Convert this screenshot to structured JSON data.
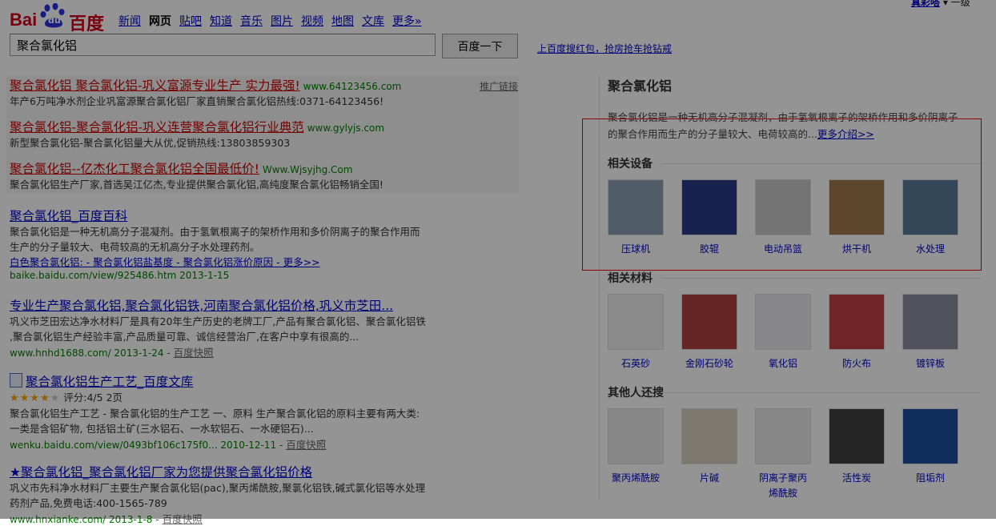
{
  "logo": {
    "text_left": "Bai",
    "text_paw": "du",
    "text_right": "百度"
  },
  "nav": [
    "新闻",
    "网页",
    "贴吧",
    "知道",
    "音乐",
    "图片",
    "视频",
    "地图",
    "文库",
    "更多»"
  ],
  "nav_active": "网页",
  "user": {
    "name": "真彩嗒",
    "setting": "一级"
  },
  "search": {
    "value": "聚合氯化铝",
    "button": "百度一下"
  },
  "promo_link": "上百度搜红包，抢房抢车抢钻戒",
  "ad_label": "推广链接",
  "ads": [
    {
      "title": "聚合氯化铝 聚合氯化铝-巩义富源专业生产 实力最强!",
      "url": "www.64123456.com",
      "desc": "年产6万吨净水剂企业巩富源聚合氯化铝厂家直销聚合氯化铝热线:0371-64123456!"
    },
    {
      "title": "聚合氯化铝-聚合氯化铝-巩义连营聚合氯化铝行业典范",
      "url": "www.gylyjs.com",
      "desc": "新型聚合氯化铝-聚合氯化铝量大从优,促销热线:13803859303"
    },
    {
      "title": "聚合氯化铝--亿杰化工聚合氯化铝全国最低价!",
      "url": "Www.Wjsyjhg.Com",
      "desc": "聚合氯化铝生产厂家,首选吴江亿杰,专业提供聚合氯化铝,高纯度聚合氯化铝畅销全国!"
    }
  ],
  "results": [
    {
      "title": "聚合氯化铝_百度百科",
      "desc1": "聚合氯化铝是一种无机高分子混凝剂。由于氢氧根离子的架桥作用和多价阴离子的聚合作用而",
      "desc2": "生产的分子量较大、电荷较高的无机高分子水处理药剂。",
      "sub": "白色聚合氯化铝: - 聚合氯化铝盐基度 - 聚合氯化铝涨价原因 - 更多>>",
      "url": "baike.baidu.com/view/925486.htm 2013-1-15"
    },
    {
      "title": "专业生产聚合氯化铝,聚合氯化铝铁,河南聚合氯化铝价格,巩义市芝田...",
      "desc1": "巩义市芝田宏达净水材料厂是具有20年生产历史的老牌工厂,产品有聚合氯化铝、聚合氯化铝铁",
      "desc2": ",聚合氯化铝生产经验丰富,产品质量可靠、诚信经营治厂,在客户中享有很高的...",
      "url": "www.hnhd1688.com/ 2013-1-24 -",
      "cache": "百度快照"
    },
    {
      "title": "聚合氯化铝生产工艺_百度文库",
      "rating": "评分:4/5 2页",
      "desc1": "聚合氯化铝生产工艺 - 聚合氯化铝的生产工艺 一、原料 生产聚合氯化铝的原料主要有两大类:",
      "desc2": "一类是含铝矿物, 包括铝土矿(三水铝石、一水软铝石、一水硬铝石)...",
      "url": "wenku.baidu.com/view/0493bf106c175f0... 2010-12-11 -",
      "cache": "百度快照"
    },
    {
      "title": "★聚合氯化铝_聚合氯化铝厂家为您提供聚合氯化铝价格",
      "desc1": "巩义市先科净水材料厂主要生产聚合氯化铝(pac),聚丙烯酰胺,聚氯化铝铁,碱式氯化铝等水处理",
      "desc2": "药剂产品,免费电话:400-1565-789",
      "url": "www.hnxianke.com/ 2013-1-8 -",
      "cache": "百度快照"
    }
  ],
  "right": {
    "title": "聚合氯化铝",
    "desc": "聚合氯化铝是一种无机高分子混凝剂，由于氢氧根离子的架桥作用和多价阴离子的聚合作用而生产的分子量较大、电荷较高的...",
    "more": "更多介绍>>",
    "sections": [
      {
        "title": "相关设备",
        "items": [
          "压球机",
          "胶辊",
          "电动吊篮",
          "烘干机",
          "水处理"
        ]
      },
      {
        "title": "相关材料",
        "items": [
          "石英砂",
          "金刚石砂轮",
          "氧化铝",
          "防火布",
          "镀锌板"
        ]
      },
      {
        "title": "其他人还搜",
        "items": [
          "聚丙烯酰胺",
          "片碱",
          "阴离子聚丙烯酰胺",
          "活性炭",
          "阻垢剂"
        ]
      }
    ]
  }
}
